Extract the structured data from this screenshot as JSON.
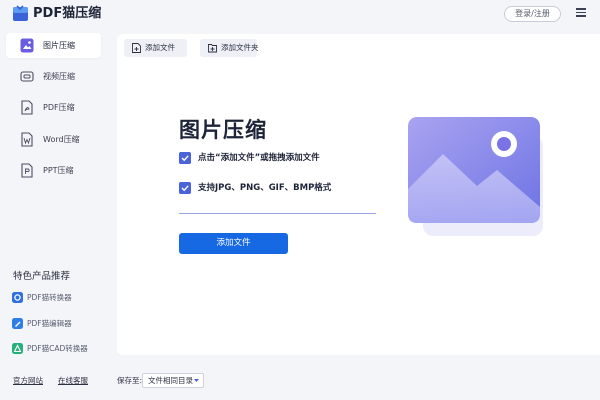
{
  "app": {
    "title": "PDF猫压缩",
    "login_label": "登录/注册"
  },
  "sidebar": {
    "items": [
      {
        "label": "图片压缩",
        "icon": "image-icon",
        "active": true
      },
      {
        "label": "视频压缩",
        "icon": "video-icon",
        "active": false
      },
      {
        "label": "PDF压缩",
        "icon": "pdf-icon",
        "active": false
      },
      {
        "label": "Word压缩",
        "icon": "word-icon",
        "active": false
      },
      {
        "label": "PPT压缩",
        "icon": "ppt-icon",
        "active": false
      }
    ],
    "featured_title": "特色产品推荐",
    "featured": [
      {
        "label": "PDF猫转换器",
        "icon": "converter-icon"
      },
      {
        "label": "PDF猫编辑器",
        "icon": "editor-icon"
      },
      {
        "label": "PDF猫CAD转换器",
        "icon": "cad-icon"
      }
    ]
  },
  "toolbar": {
    "add_file_label": "添加文件",
    "add_folder_label": "添加文件夹"
  },
  "main": {
    "heading": "图片压缩",
    "checks": [
      "点击“添加文件”或拖拽添加文件",
      "支持JPG、PNG、GIF、BMP格式"
    ],
    "add_button_label": "添加文件"
  },
  "footer": {
    "official_site": "官方网站",
    "online_service": "在线客服",
    "save_to_label": "保存至:",
    "save_to_value": "文件相同目录"
  },
  "colors": {
    "accent": "#1668e3",
    "checkbox": "#4a63d8",
    "illustration": "#7f84e8"
  }
}
